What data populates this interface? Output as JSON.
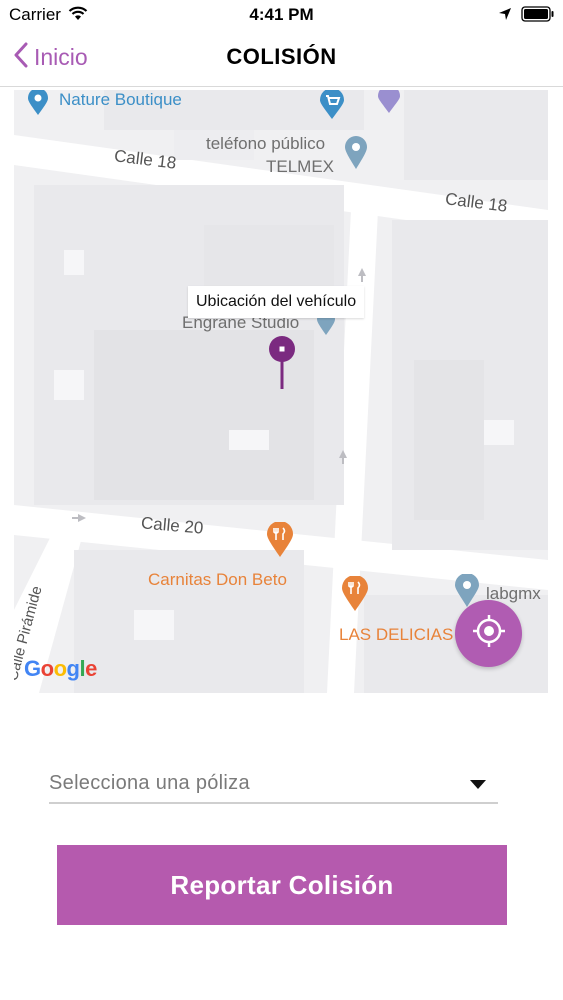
{
  "status_bar": {
    "carrier": "Carrier",
    "time": "4:41 PM",
    "icons": [
      "wifi-icon",
      "location-arrow-icon",
      "battery-icon"
    ]
  },
  "nav": {
    "back_label": "Inicio",
    "title": "COLISIÓN"
  },
  "map": {
    "labels": {
      "nature_boutique": "Nature Boutique",
      "telefono_line1": "teléfono público",
      "telefono_line2": "TELMEX",
      "calle18_left": "Calle 18",
      "calle18_right": "Calle 18",
      "engrane": "Engrane Studio",
      "calle20": "Calle 20",
      "carnitas": "Carnitas Don Beto",
      "las_delicias": "LAS DELICIAS",
      "labgmx": "labgmx",
      "calle_piramide": "Calle Pirámide"
    },
    "callout": "Ubicación del vehículo",
    "attribution": [
      "G",
      "o",
      "o",
      "g",
      "l",
      "e"
    ],
    "colors": {
      "pin_purple": "#7b2a80",
      "poi_blue": "#3c8fc7",
      "poi_orange": "#e8833a",
      "locate_button": "#b05cb2"
    }
  },
  "policy_select": {
    "placeholder": "Selecciona una póliza"
  },
  "report_button": {
    "label": "Reportar Colisión",
    "color": "#b55aae"
  }
}
